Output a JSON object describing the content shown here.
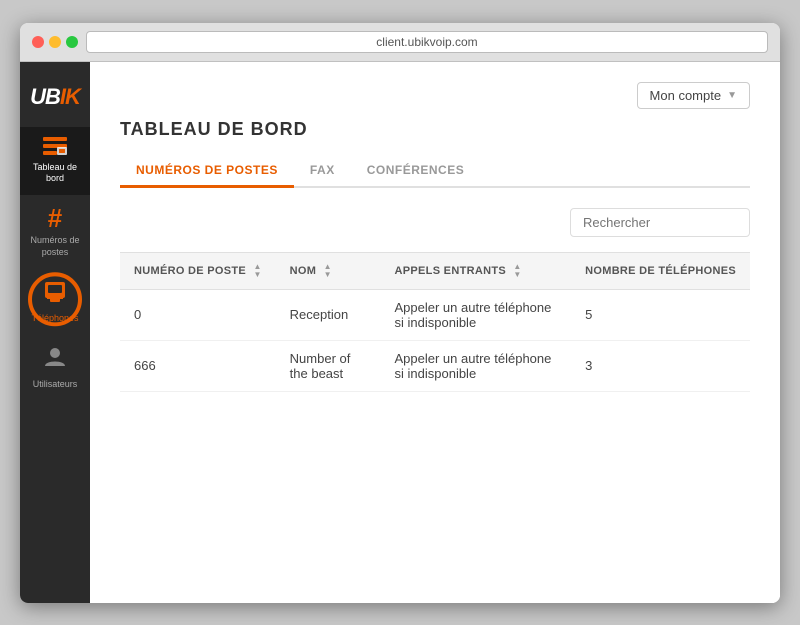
{
  "browser": {
    "url": "client.ubikvoip.com"
  },
  "header": {
    "account_button": "Mon compte"
  },
  "sidebar": {
    "logo": "UBIK",
    "items": [
      {
        "id": "dashboard",
        "label": "Tableau de\nbord",
        "icon": "📞",
        "active": true,
        "highlighted": false
      },
      {
        "id": "numeros",
        "label": "Numéros de\npostes",
        "icon": "#",
        "active": false,
        "highlighted": false
      },
      {
        "id": "telephones",
        "label": "Téléphones",
        "icon": "📱",
        "active": false,
        "highlighted": true
      },
      {
        "id": "utilisateurs",
        "label": "Utilisateurs",
        "icon": "👤",
        "active": false,
        "highlighted": false
      }
    ]
  },
  "page": {
    "title": "TABLEAU DE BORD",
    "tabs": [
      {
        "id": "numeros",
        "label": "NUMÉROS DE POSTES",
        "active": true
      },
      {
        "id": "fax",
        "label": "FAX",
        "active": false
      },
      {
        "id": "conferences",
        "label": "CONFÉRENCES",
        "active": false
      }
    ],
    "search_placeholder": "Rechercher",
    "table": {
      "columns": [
        {
          "id": "numero",
          "label": "NUMÉRO DE POSTE"
        },
        {
          "id": "nom",
          "label": "NOM"
        },
        {
          "id": "appels",
          "label": "APPELS ENTRANTS"
        },
        {
          "id": "telephones",
          "label": "NOMBRE DE TÉLÉPHONES"
        }
      ],
      "rows": [
        {
          "numero": "0",
          "nom": "Reception",
          "appels": "Appeler un autre téléphone si indisponible",
          "telephones": "5"
        },
        {
          "numero": "666",
          "nom": "Number of the beast",
          "appels": "Appeler un autre téléphone si indisponible",
          "telephones": "3"
        }
      ]
    }
  }
}
